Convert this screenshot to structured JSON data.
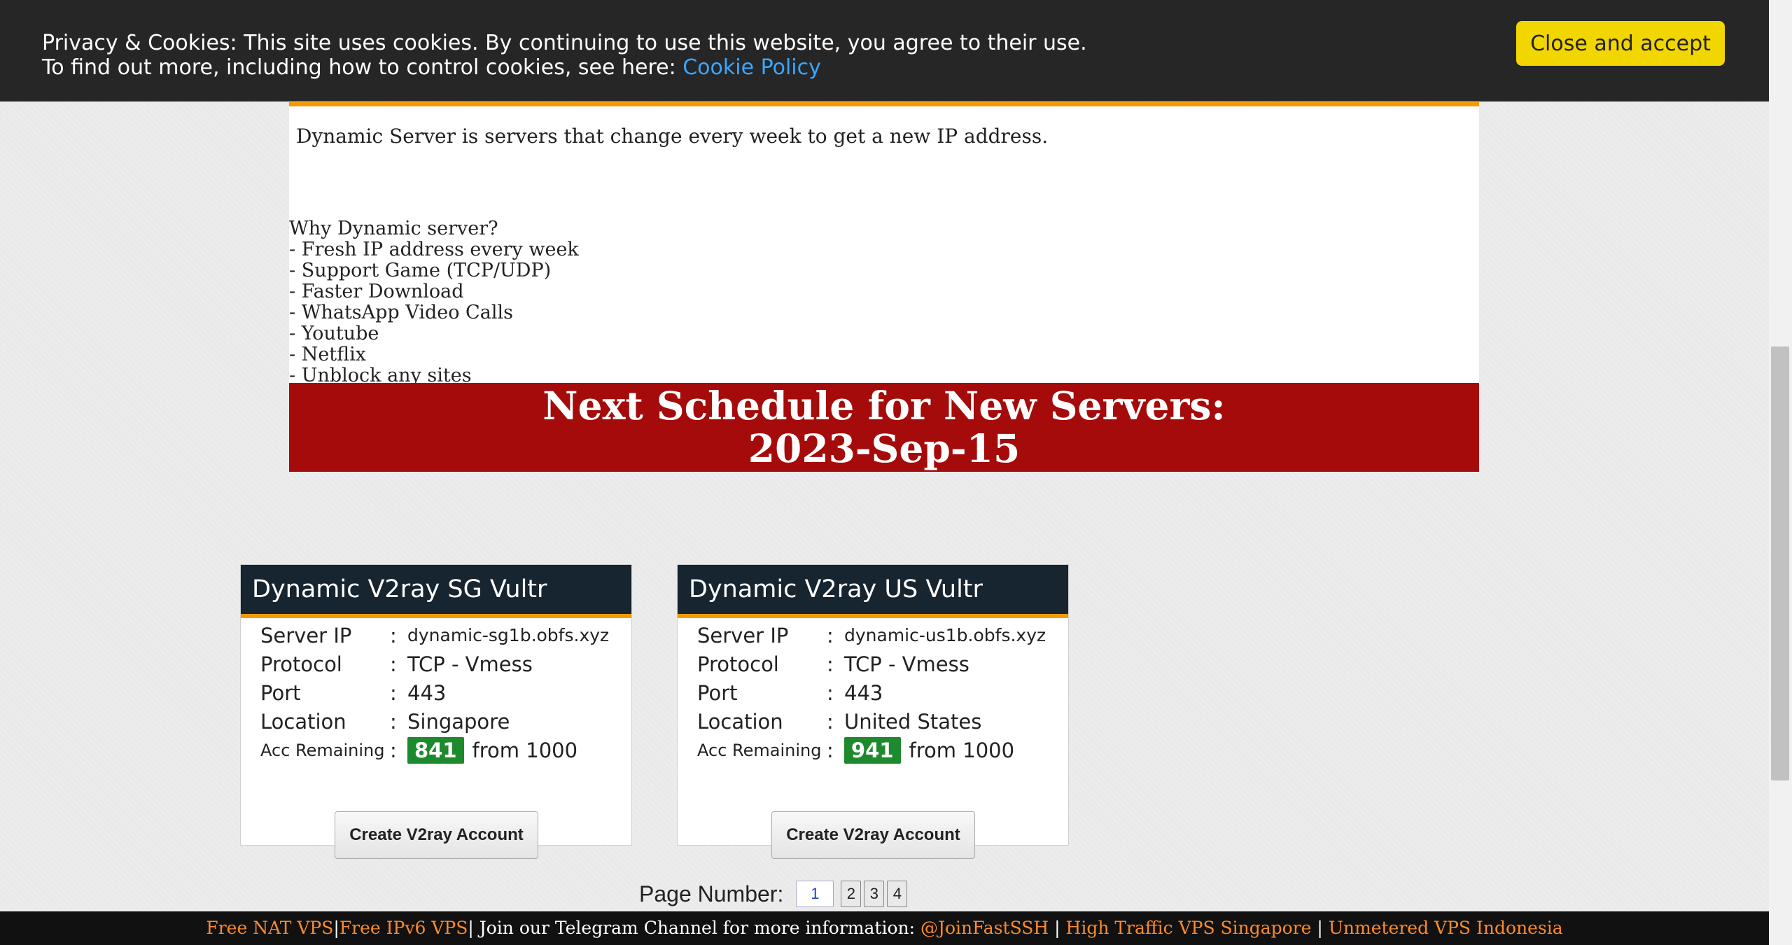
{
  "cookie": {
    "line1": "Privacy & Cookies: This site uses cookies. By continuing to use this website, you agree to their use.",
    "line2_prefix": "To find out more, including how to control cookies, see here: ",
    "policy_link": "Cookie Policy",
    "accept_label": "Close and accept"
  },
  "content": {
    "intro": "Dynamic Server is servers that change every week to get a new IP address.",
    "why_title": "Why Dynamic server?",
    "why_items": [
      "- Fresh IP address every week",
      "- Support Game (TCP/UDP)",
      "- Faster Download",
      "- WhatsApp Video Calls",
      "- Youtube",
      "- Netflix",
      "- Unblock any sites"
    ]
  },
  "schedule": {
    "line1": "Next Schedule for New Servers:",
    "line2": "2023-Sep-15"
  },
  "servers": [
    {
      "title": "Dynamic V2ray SG Vultr",
      "labels": {
        "ip": "Server IP",
        "protocol": "Protocol",
        "port": "Port",
        "location": "Location",
        "remaining": "Acc Remaining"
      },
      "colon": ":",
      "ip": "dynamic-sg1b.obfs.xyz",
      "protocol": "TCP - Vmess",
      "port": "443",
      "location": "Singapore",
      "remaining": "841",
      "total": "from 1000",
      "button": "Create V2ray Account"
    },
    {
      "title": "Dynamic V2ray US Vultr",
      "labels": {
        "ip": "Server IP",
        "protocol": "Protocol",
        "port": "Port",
        "location": "Location",
        "remaining": "Acc Remaining"
      },
      "colon": ":",
      "ip": "dynamic-us1b.obfs.xyz",
      "protocol": "TCP - Vmess",
      "port": "443",
      "location": "United States",
      "remaining": "941",
      "total": "from 1000",
      "button": "Create V2ray Account"
    }
  ],
  "pagination": {
    "label": "Page Number:",
    "pages": [
      "1",
      "2",
      "3",
      "4"
    ],
    "current": "1"
  },
  "footer": {
    "link1": "Free NAT VPS",
    "sep1": "|",
    "link2": "Free IPv6 VPS",
    "text": "| Join our Telegram Channel for more information: ",
    "link3": "@JoinFastSSH",
    "sep2": " | ",
    "link4": "High Traffic VPS Singapore",
    "sep3": " | ",
    "link5": "Unmetered VPS Indonesia"
  }
}
